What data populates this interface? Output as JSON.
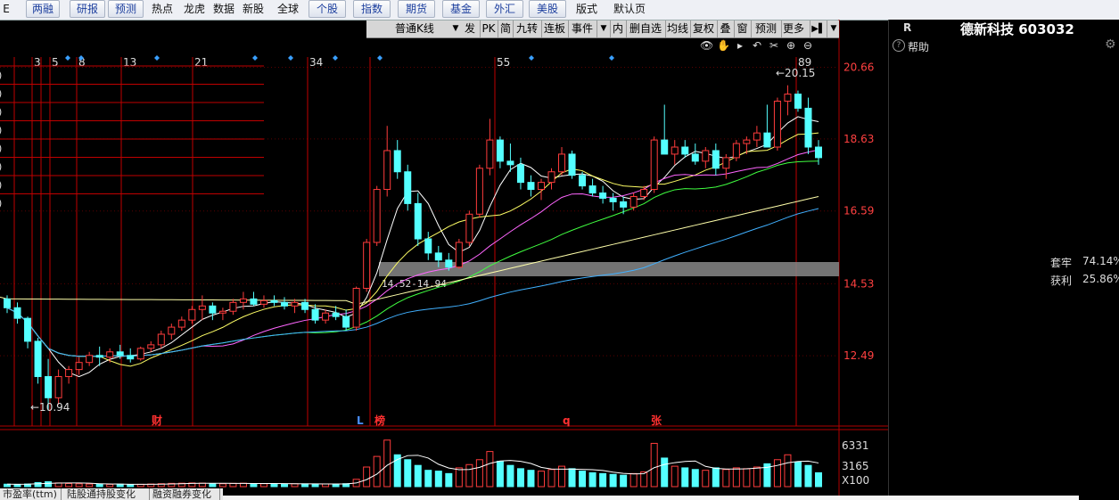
{
  "top_nav": {
    "items": [
      {
        "label": "E",
        "style": "plain"
      },
      {
        "label": "两融",
        "style": "btn"
      },
      {
        "label": "研报",
        "style": "btn"
      },
      {
        "label": "预测",
        "style": "btn"
      },
      {
        "label": "热点",
        "style": "plain"
      },
      {
        "label": "龙虎",
        "style": "plain"
      },
      {
        "label": "数据",
        "style": "plain"
      },
      {
        "label": "新股",
        "style": "plain"
      },
      {
        "label": "全球",
        "style": "plain"
      },
      {
        "label": "个股",
        "style": "btn"
      },
      {
        "label": "指数",
        "style": "btn"
      },
      {
        "label": "期货",
        "style": "btn"
      },
      {
        "label": "基金",
        "style": "btn"
      },
      {
        "label": "外汇",
        "style": "btn"
      },
      {
        "label": "美股",
        "style": "btn"
      },
      {
        "label": "版式",
        "style": "plain"
      },
      {
        "label": "默认页",
        "style": "plain"
      }
    ]
  },
  "toolbar": {
    "kline_type": "普通K线",
    "kline_arrow": "▼",
    "items": [
      "发",
      "PK",
      "简",
      "九转",
      "连板",
      "事件",
      "▼",
      "内",
      "删自选",
      "均线",
      "复权",
      "叠",
      "窗",
      "预测",
      "更多"
    ],
    "pin_icon": "▶▌",
    "more_arrow": "▼"
  },
  "chart_tools": [
    "👁",
    "✋",
    "▸",
    "↶",
    "✂",
    "⊕",
    "⊖"
  ],
  "stock": {
    "code_prefix": "R",
    "name_code": "德新科技 603032"
  },
  "help_label": "帮助",
  "price_axis": [
    "20.66",
    "18.63",
    "16.59",
    "14.53",
    "12.49"
  ],
  "volume_axis": [
    "6331",
    "3165",
    "X100"
  ],
  "day_markers": [
    "3",
    "5",
    "8",
    "13",
    "21",
    "34",
    "55",
    "89"
  ],
  "extreme_labels": {
    "high": "20.15",
    "low": "10.94"
  },
  "zone_label": "14.52-14.94",
  "event_tags": [
    {
      "label": "财",
      "color": "#ff3030"
    },
    {
      "label": "L",
      "color": "#4a90ff"
    },
    {
      "label": "榜",
      "color": "#ff3030"
    },
    {
      "label": "q",
      "color": "#ff3030"
    },
    {
      "label": "张",
      "color": "#ff3030"
    }
  ],
  "chip_stats": {
    "trapped_label": "套牢",
    "trapped_value": "74.14%",
    "profit_label": "获利",
    "profit_value": "25.86%"
  },
  "bottom_tabs": [
    "市盈率(ttm)",
    "陆股通持股变化",
    "融资融券变化"
  ],
  "colors": {
    "up": "#ff3c3c",
    "down": "#54ffff",
    "grid": "#8b0000",
    "ma5": "#ffffff",
    "ma10": "#ffff66",
    "ma20": "#ff66ff",
    "ma30": "#40ff40",
    "ma60": "#40b0ff",
    "ma120": "#ffffaa"
  },
  "chart_data": {
    "type": "candlestick",
    "y_range": [
      10.5,
      21.0
    ],
    "candles": [
      [
        14.1,
        14.2,
        13.7,
        13.85
      ],
      [
        13.85,
        14.0,
        13.4,
        13.55
      ],
      [
        13.55,
        13.6,
        12.7,
        12.9
      ],
      [
        12.9,
        13.0,
        11.7,
        11.9
      ],
      [
        11.9,
        12.4,
        10.94,
        11.3
      ],
      [
        11.3,
        12.1,
        11.1,
        11.9
      ],
      [
        11.9,
        12.2,
        11.7,
        12.1
      ],
      [
        12.1,
        12.45,
        11.95,
        12.3
      ],
      [
        12.3,
        12.6,
        12.2,
        12.5
      ],
      [
        12.5,
        12.75,
        12.2,
        12.45
      ],
      [
        12.45,
        12.7,
        12.3,
        12.6
      ],
      [
        12.6,
        12.8,
        12.4,
        12.5
      ],
      [
        12.5,
        12.7,
        12.3,
        12.4
      ],
      [
        12.4,
        12.75,
        12.35,
        12.7
      ],
      [
        12.7,
        12.9,
        12.6,
        12.8
      ],
      [
        12.8,
        13.2,
        12.7,
        13.1
      ],
      [
        13.1,
        13.4,
        12.95,
        13.3
      ],
      [
        13.3,
        13.6,
        13.2,
        13.5
      ],
      [
        13.5,
        13.9,
        13.4,
        13.8
      ],
      [
        13.8,
        14.2,
        13.5,
        13.9
      ],
      [
        13.9,
        14.0,
        13.5,
        13.7
      ],
      [
        13.7,
        13.85,
        13.5,
        13.75
      ],
      [
        13.75,
        14.1,
        13.65,
        14.0
      ],
      [
        14.0,
        14.3,
        13.8,
        14.1
      ],
      [
        14.1,
        14.3,
        13.9,
        13.95
      ],
      [
        13.95,
        14.2,
        13.85,
        14.05
      ],
      [
        14.05,
        14.2,
        13.9,
        14.0
      ],
      [
        14.0,
        14.15,
        13.8,
        13.9
      ],
      [
        13.9,
        14.1,
        13.7,
        14.0
      ],
      [
        14.0,
        14.1,
        13.7,
        13.8
      ],
      [
        13.8,
        13.95,
        13.4,
        13.5
      ],
      [
        13.5,
        13.8,
        13.4,
        13.7
      ],
      [
        13.7,
        13.9,
        13.5,
        13.6
      ],
      [
        13.6,
        13.8,
        13.2,
        13.3
      ],
      [
        13.3,
        14.45,
        13.2,
        14.4
      ],
      [
        14.4,
        15.8,
        14.3,
        15.7
      ],
      [
        15.7,
        17.3,
        15.6,
        17.2
      ],
      [
        17.2,
        19.0,
        17.0,
        18.3
      ],
      [
        18.3,
        18.6,
        17.5,
        17.7
      ],
      [
        17.7,
        17.9,
        16.6,
        16.8
      ],
      [
        16.8,
        17.1,
        15.6,
        15.8
      ],
      [
        15.8,
        16.0,
        15.2,
        15.4
      ],
      [
        15.4,
        15.6,
        15.0,
        15.2
      ],
      [
        15.2,
        15.4,
        14.9,
        15.0
      ],
      [
        15.0,
        15.8,
        14.95,
        15.7
      ],
      [
        15.7,
        16.6,
        15.6,
        16.5
      ],
      [
        16.5,
        17.9,
        16.4,
        17.8
      ],
      [
        17.8,
        19.2,
        17.6,
        18.6
      ],
      [
        18.6,
        18.7,
        17.8,
        18.0
      ],
      [
        18.0,
        18.5,
        17.7,
        17.9
      ],
      [
        17.9,
        18.1,
        17.2,
        17.4
      ],
      [
        17.4,
        17.6,
        17.0,
        17.2
      ],
      [
        17.2,
        17.5,
        16.9,
        17.4
      ],
      [
        17.4,
        17.8,
        17.2,
        17.7
      ],
      [
        17.7,
        18.4,
        17.6,
        18.2
      ],
      [
        18.2,
        18.3,
        17.5,
        17.6
      ],
      [
        17.6,
        17.7,
        17.2,
        17.3
      ],
      [
        17.3,
        17.5,
        17.0,
        17.1
      ],
      [
        17.1,
        17.3,
        16.8,
        16.95
      ],
      [
        16.95,
        17.1,
        16.6,
        16.85
      ],
      [
        16.85,
        17.0,
        16.5,
        16.7
      ],
      [
        16.7,
        17.1,
        16.6,
        17.0
      ],
      [
        17.0,
        17.3,
        16.9,
        17.2
      ],
      [
        17.2,
        18.7,
        17.1,
        18.6
      ],
      [
        18.6,
        19.6,
        18.4,
        18.2
      ],
      [
        18.2,
        18.6,
        17.9,
        18.4
      ],
      [
        18.4,
        18.6,
        18.1,
        18.2
      ],
      [
        18.2,
        18.5,
        17.9,
        18.0
      ],
      [
        18.0,
        18.4,
        17.8,
        18.3
      ],
      [
        18.3,
        18.5,
        17.6,
        17.8
      ],
      [
        17.8,
        18.2,
        17.5,
        18.1
      ],
      [
        18.1,
        18.6,
        18.0,
        18.5
      ],
      [
        18.5,
        18.7,
        18.2,
        18.6
      ],
      [
        18.6,
        19.0,
        18.4,
        18.8
      ],
      [
        18.8,
        19.6,
        18.6,
        18.4
      ],
      [
        18.4,
        19.8,
        18.3,
        19.7
      ],
      [
        19.7,
        20.15,
        19.3,
        19.9
      ],
      [
        19.9,
        20.0,
        19.4,
        19.5
      ],
      [
        19.5,
        19.8,
        18.2,
        18.4
      ],
      [
        18.4,
        18.6,
        17.9,
        18.1
      ]
    ],
    "volumes": [
      300,
      280,
      320,
      500,
      600,
      450,
      380,
      350,
      320,
      300,
      280,
      300,
      260,
      280,
      320,
      360,
      400,
      420,
      450,
      430,
      380,
      350,
      400,
      420,
      380,
      360,
      340,
      330,
      350,
      340,
      320,
      330,
      310,
      360,
      900,
      2400,
      3700,
      5700,
      3900,
      3300,
      2600,
      2000,
      1900,
      1600,
      2300,
      2700,
      3300,
      4300,
      3100,
      2600,
      2200,
      2000,
      1900,
      2100,
      2500,
      2200,
      1900,
      1700,
      1600,
      1500,
      1400,
      1600,
      1800,
      5300,
      3500,
      2500,
      2300,
      2100,
      2000,
      2300,
      2100,
      2300,
      2200,
      2400,
      2800,
      3300,
      3900,
      3000,
      2600,
      1700
    ]
  }
}
